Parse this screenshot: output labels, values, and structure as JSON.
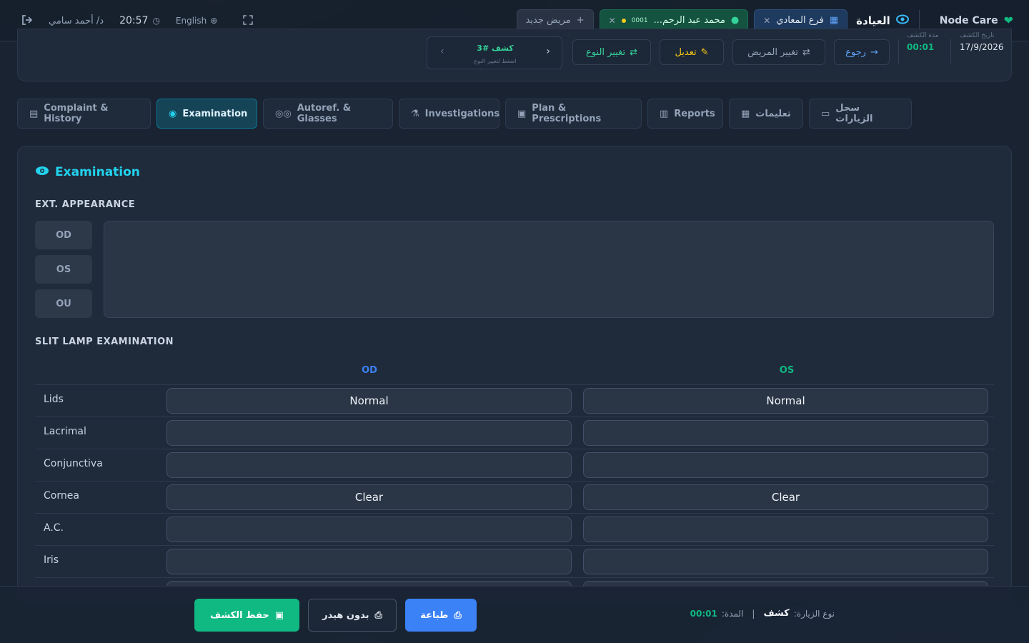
{
  "topbar": {
    "brand": "Node Care",
    "clinic": "العيادة",
    "branch": "فرع المعادي",
    "patient_name": "محمد عبد الرحم...",
    "patient_code": "0001",
    "new_patient": "مريض جديد",
    "language": "English",
    "time": "20:57",
    "user": "د/ أحمد سامي"
  },
  "header": {
    "exam_date_label": "تاريخ الكشف",
    "exam_date": "17/9/2026",
    "duration_label": "مدة الكشف",
    "duration": "00:01",
    "back": "رجوع",
    "change_patient": "تغيير المريض",
    "edit": "تعديل",
    "change_type": "تغيير النوع",
    "visit_label": "كشف #3",
    "visit_hint": "اضغط لتغيير النوع"
  },
  "tabs": [
    {
      "label": "Complaint & History"
    },
    {
      "label": "Examination"
    },
    {
      "label": "Autoref. & Glasses"
    },
    {
      "label": "Investigations"
    },
    {
      "label": "Plan & Prescriptions"
    },
    {
      "label": "Reports"
    },
    {
      "label": "تعليمات"
    },
    {
      "label": "سجل الزيارات"
    }
  ],
  "examination": {
    "title": "Examination",
    "ext_title": "EXT. APPEARANCE",
    "eye_buttons": [
      "OD",
      "OS",
      "OU"
    ],
    "slit_title": "SLIT LAMP EXAMINATION",
    "od_header": "OD",
    "os_header": "OS",
    "rows": [
      {
        "label": "Lids",
        "od": "Normal",
        "os": "Normal"
      },
      {
        "label": "Lacrimal",
        "od": "",
        "os": ""
      },
      {
        "label": "Conjunctiva",
        "od": "",
        "os": ""
      },
      {
        "label": "Cornea",
        "od": "Clear",
        "os": "Clear"
      },
      {
        "label": "A.C.",
        "od": "",
        "os": ""
      },
      {
        "label": "Iris",
        "od": "",
        "os": ""
      }
    ]
  },
  "footer": {
    "save": "حفظ الكشف",
    "no_header": "بدون هيدر",
    "print": "طباعة",
    "visit_type_label": "نوع الزيارة:",
    "visit_type": "كشف",
    "duration_label": "المدة:",
    "duration": "00:01"
  },
  "colors": {
    "accent": "#22d3ee",
    "od": "#3b82f6",
    "os": "#10b981",
    "save": "#10b981",
    "print": "#3b82f6"
  }
}
